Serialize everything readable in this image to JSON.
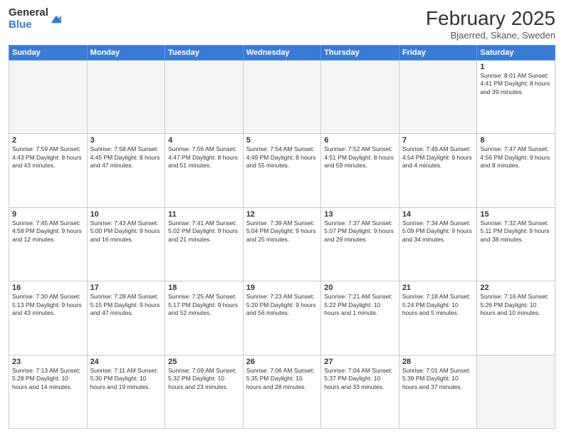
{
  "header": {
    "logo_general": "General",
    "logo_blue": "Blue",
    "month_year": "February 2025",
    "location": "Bjaerred, Skane, Sweden"
  },
  "days_of_week": [
    "Sunday",
    "Monday",
    "Tuesday",
    "Wednesday",
    "Thursday",
    "Friday",
    "Saturday"
  ],
  "weeks": [
    [
      {
        "num": "",
        "info": ""
      },
      {
        "num": "",
        "info": ""
      },
      {
        "num": "",
        "info": ""
      },
      {
        "num": "",
        "info": ""
      },
      {
        "num": "",
        "info": ""
      },
      {
        "num": "",
        "info": ""
      },
      {
        "num": "1",
        "info": "Sunrise: 8:01 AM\nSunset: 4:41 PM\nDaylight: 8 hours and 39 minutes."
      }
    ],
    [
      {
        "num": "2",
        "info": "Sunrise: 7:59 AM\nSunset: 4:43 PM\nDaylight: 8 hours and 43 minutes."
      },
      {
        "num": "3",
        "info": "Sunrise: 7:58 AM\nSunset: 4:45 PM\nDaylight: 8 hours and 47 minutes."
      },
      {
        "num": "4",
        "info": "Sunrise: 7:56 AM\nSunset: 4:47 PM\nDaylight: 8 hours and 51 minutes."
      },
      {
        "num": "5",
        "info": "Sunrise: 7:54 AM\nSunset: 4:49 PM\nDaylight: 8 hours and 55 minutes."
      },
      {
        "num": "6",
        "info": "Sunrise: 7:52 AM\nSunset: 4:51 PM\nDaylight: 8 hours and 59 minutes."
      },
      {
        "num": "7",
        "info": "Sunrise: 7:49 AM\nSunset: 4:54 PM\nDaylight: 9 hours and 4 minutes."
      },
      {
        "num": "8",
        "info": "Sunrise: 7:47 AM\nSunset: 4:56 PM\nDaylight: 9 hours and 8 minutes."
      }
    ],
    [
      {
        "num": "9",
        "info": "Sunrise: 7:45 AM\nSunset: 4:58 PM\nDaylight: 9 hours and 12 minutes."
      },
      {
        "num": "10",
        "info": "Sunrise: 7:43 AM\nSunset: 5:00 PM\nDaylight: 9 hours and 16 minutes."
      },
      {
        "num": "11",
        "info": "Sunrise: 7:41 AM\nSunset: 5:02 PM\nDaylight: 9 hours and 21 minutes."
      },
      {
        "num": "12",
        "info": "Sunrise: 7:39 AM\nSunset: 5:04 PM\nDaylight: 9 hours and 25 minutes."
      },
      {
        "num": "13",
        "info": "Sunrise: 7:37 AM\nSunset: 5:07 PM\nDaylight: 9 hours and 29 minutes."
      },
      {
        "num": "14",
        "info": "Sunrise: 7:34 AM\nSunset: 5:09 PM\nDaylight: 9 hours and 34 minutes."
      },
      {
        "num": "15",
        "info": "Sunrise: 7:32 AM\nSunset: 5:11 PM\nDaylight: 9 hours and 38 minutes."
      }
    ],
    [
      {
        "num": "16",
        "info": "Sunrise: 7:30 AM\nSunset: 5:13 PM\nDaylight: 9 hours and 43 minutes."
      },
      {
        "num": "17",
        "info": "Sunrise: 7:28 AM\nSunset: 5:15 PM\nDaylight: 9 hours and 47 minutes."
      },
      {
        "num": "18",
        "info": "Sunrise: 7:25 AM\nSunset: 5:17 PM\nDaylight: 9 hours and 52 minutes."
      },
      {
        "num": "19",
        "info": "Sunrise: 7:23 AM\nSunset: 5:20 PM\nDaylight: 9 hours and 56 minutes."
      },
      {
        "num": "20",
        "info": "Sunrise: 7:21 AM\nSunset: 5:22 PM\nDaylight: 10 hours and 1 minute."
      },
      {
        "num": "21",
        "info": "Sunrise: 7:18 AM\nSunset: 5:24 PM\nDaylight: 10 hours and 5 minutes."
      },
      {
        "num": "22",
        "info": "Sunrise: 7:16 AM\nSunset: 5:26 PM\nDaylight: 10 hours and 10 minutes."
      }
    ],
    [
      {
        "num": "23",
        "info": "Sunrise: 7:13 AM\nSunset: 5:28 PM\nDaylight: 10 hours and 14 minutes."
      },
      {
        "num": "24",
        "info": "Sunrise: 7:11 AM\nSunset: 5:30 PM\nDaylight: 10 hours and 19 minutes."
      },
      {
        "num": "25",
        "info": "Sunrise: 7:09 AM\nSunset: 5:32 PM\nDaylight: 10 hours and 23 minutes."
      },
      {
        "num": "26",
        "info": "Sunrise: 7:06 AM\nSunset: 5:35 PM\nDaylight: 10 hours and 28 minutes."
      },
      {
        "num": "27",
        "info": "Sunrise: 7:04 AM\nSunset: 5:37 PM\nDaylight: 10 hours and 33 minutes."
      },
      {
        "num": "28",
        "info": "Sunrise: 7:01 AM\nSunset: 5:39 PM\nDaylight: 10 hours and 37 minutes."
      },
      {
        "num": "",
        "info": ""
      }
    ]
  ]
}
